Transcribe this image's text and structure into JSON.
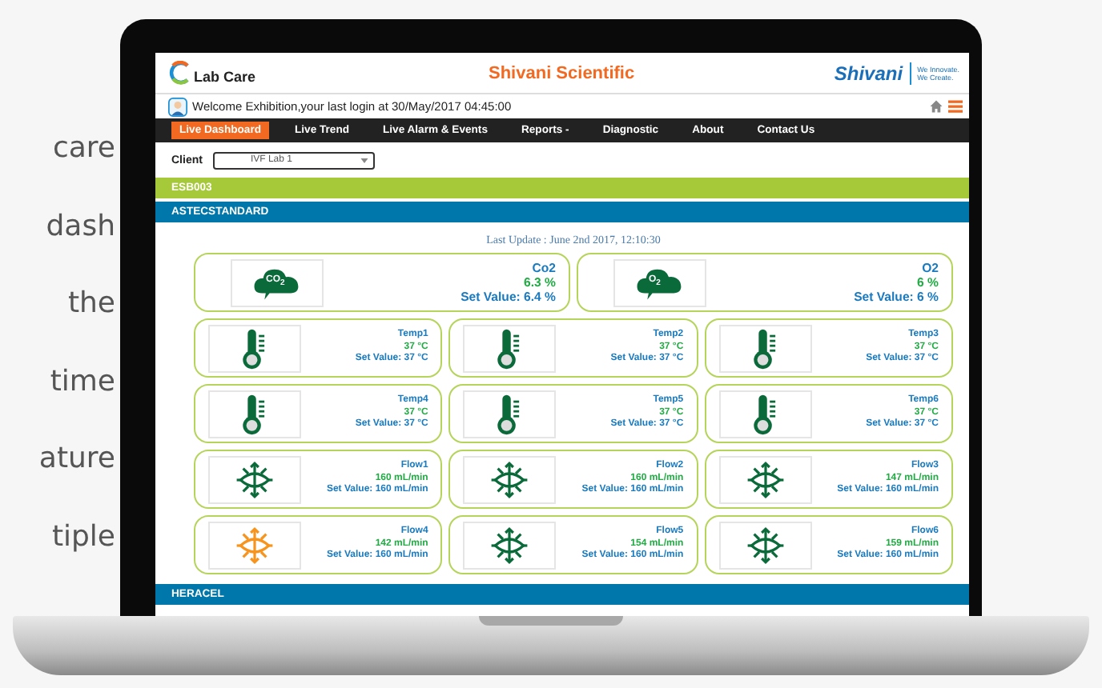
{
  "side_text": [
    "care",
    "dash",
    "the",
    "time",
    "ature",
    "tiple"
  ],
  "header": {
    "logo_text": "Lab Care",
    "title": "Shivani Scientific",
    "brand": "Shivani",
    "slogan": [
      "We Innovate.",
      "We Create."
    ]
  },
  "welcome": "Welcome Exhibition,your last login at 30/May/2017 04:45:00",
  "nav": [
    {
      "label": "Live Dashboard",
      "selected": true
    },
    {
      "label": "Live Trend",
      "selected": false
    },
    {
      "label": "Live Alarm & Events",
      "selected": false
    },
    {
      "label": "Reports -",
      "selected": false
    },
    {
      "label": "Diagnostic",
      "selected": false
    },
    {
      "label": "About",
      "selected": false
    },
    {
      "label": "Contact Us",
      "selected": false
    }
  ],
  "client": {
    "label": "Client",
    "value": "IVF Lab 1"
  },
  "groups": [
    {
      "name": "ESB003",
      "color": "#a6c93a"
    },
    {
      "name": "ASTECSTANDARD",
      "color": "#0077aa",
      "last_update": "Last Update : June 2nd 2017, 12:10:30",
      "sensors": [
        {
          "kind": "gas",
          "symbol": "CO$_{2}$",
          "name": "Co2",
          "reading": "6.3 %",
          "set_value": "Set Value: 6.4 %",
          "alarm": false
        },
        {
          "kind": "gas",
          "symbol": "O$_{2}$",
          "name": "O2",
          "reading": "6 %",
          "set_value": "Set Value: 6 %",
          "alarm": false
        },
        {
          "kind": "temp",
          "name": "Temp1",
          "reading": "37 °C",
          "set_value": "Set Value: 37 °C",
          "alarm": false
        },
        {
          "kind": "temp",
          "name": "Temp2",
          "reading": "37 °C",
          "set_value": "Set Value: 37 °C",
          "alarm": false
        },
        {
          "kind": "temp",
          "name": "Temp3",
          "reading": "37 °C",
          "set_value": "Set Value: 37 °C",
          "alarm": false
        },
        {
          "kind": "temp",
          "name": "Temp4",
          "reading": "37 °C",
          "set_value": "Set Value: 37 °C",
          "alarm": false
        },
        {
          "kind": "temp",
          "name": "Temp5",
          "reading": "37 °C",
          "set_value": "Set Value: 37 °C",
          "alarm": false
        },
        {
          "kind": "temp",
          "name": "Temp6",
          "reading": "37 °C",
          "set_value": "Set Value: 37 °C",
          "alarm": false
        },
        {
          "kind": "flow",
          "name": "Flow1",
          "reading": "160 mL/min",
          "set_value": "Set Value: 160 mL/min",
          "alarm": false
        },
        {
          "kind": "flow",
          "name": "Flow2",
          "reading": "160 mL/min",
          "set_value": "Set Value: 160 mL/min",
          "alarm": false
        },
        {
          "kind": "flow",
          "name": "Flow3",
          "reading": "147 mL/min",
          "set_value": "Set Value: 160 mL/min",
          "alarm": false
        },
        {
          "kind": "flow",
          "name": "Flow4",
          "reading": "142 mL/min",
          "set_value": "Set Value: 160 mL/min",
          "alarm": true
        },
        {
          "kind": "flow",
          "name": "Flow5",
          "reading": "154 mL/min",
          "set_value": "Set Value: 160 mL/min",
          "alarm": false
        },
        {
          "kind": "flow",
          "name": "Flow6",
          "reading": "159 mL/min",
          "set_value": "Set Value: 160 mL/min",
          "alarm": false
        }
      ]
    },
    {
      "name": "HERACEL",
      "color": "#0077aa"
    }
  ]
}
